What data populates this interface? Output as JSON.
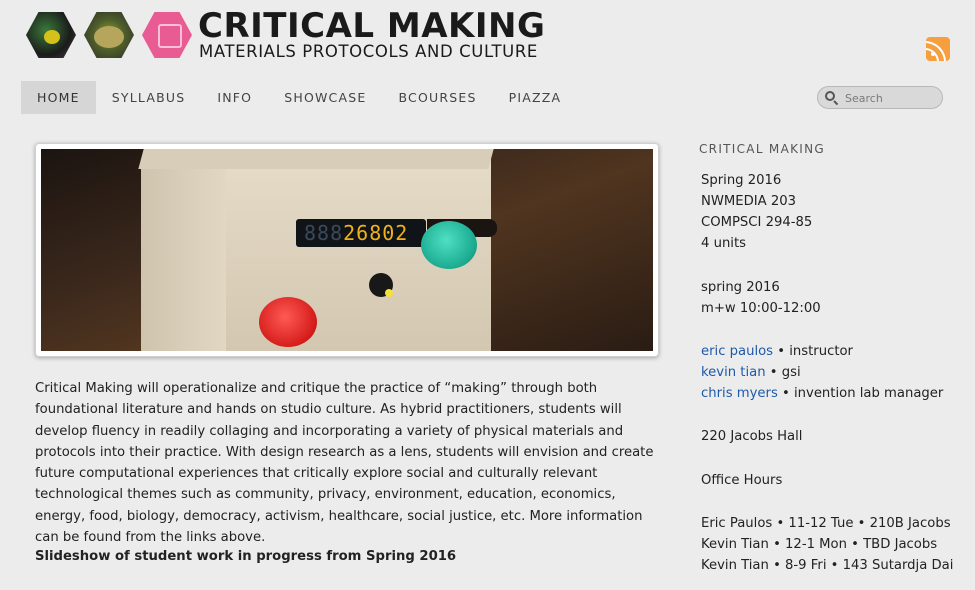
{
  "header": {
    "title": "CRITICAL MAKING",
    "subtitle": "MATERIALS PROTOCOLS AND CULTURE",
    "icons": {
      "rss": "rss-icon",
      "search": "search-icon"
    },
    "rss_color": "#f59f3e"
  },
  "nav": {
    "items": [
      {
        "label": "HOME",
        "active": true
      },
      {
        "label": "SYLLABUS"
      },
      {
        "label": "INFO"
      },
      {
        "label": "SHOWCASE"
      },
      {
        "label": "BCOURSES"
      },
      {
        "label": "PIAZZA"
      }
    ]
  },
  "search": {
    "placeholder": "Search",
    "value": ""
  },
  "hero": {
    "display_dim": "888",
    "display_lit": "26802"
  },
  "main": {
    "intro": "Critical Making will operationalize and critique the practice of “making” through both foundational literature and hands on studio culture. As hybrid practitioners, students will develop fluency in readily collaging and incorporating a variety of physical materials and protocols into their practice. With design research as a lens, students will envision and create future computational experiences that critically explore social and culturally relevant technological themes such as community, privacy, environment, education, economics, energy, food, biology, democracy, activism, healthcare, social justice, etc. More information can be found from the links above.",
    "slideshow_title": "Slideshow of student work in progress from Spring 2016"
  },
  "sidebar": {
    "heading": "CRITICAL MAKING",
    "course": [
      "Spring 2016",
      "NWMEDIA 203",
      "COMPSCI 294-85",
      "4 units"
    ],
    "schedule": [
      "spring 2016",
      "m+w 10:00-12:00"
    ],
    "staff": [
      {
        "name": "eric paulos",
        "role": " • instructor"
      },
      {
        "name": "kevin tian",
        "role": " • gsi"
      },
      {
        "name": "chris myers",
        "role": " • invention lab manager"
      }
    ],
    "location": "220 Jacobs Hall",
    "office_hours_label": "Office Hours",
    "office_hours": [
      "Eric Paulos • 11-12 Tue • 210B Jacobs",
      "Kevin Tian • 12-1 Mon • TBD Jacobs",
      "Kevin Tian • 8-9 Fri • 143 Sutardja Dai"
    ],
    "link_color": "#1d5aa8"
  }
}
